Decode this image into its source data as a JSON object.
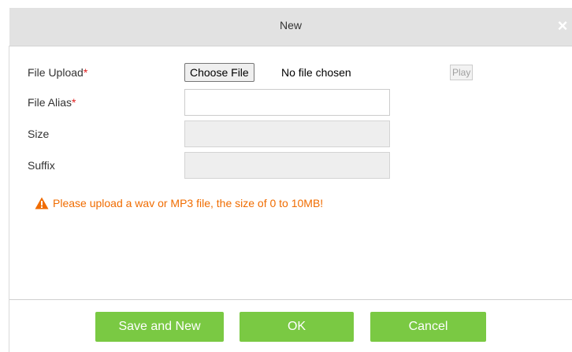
{
  "dialog": {
    "title": "New",
    "close_glyph": "×"
  },
  "form": {
    "file_upload": {
      "label": "File Upload",
      "required_mark": "*",
      "choose_button": "Choose File",
      "status": "No file chosen",
      "play_button": "Play"
    },
    "file_alias": {
      "label": "File Alias",
      "required_mark": "*",
      "value": ""
    },
    "size": {
      "label": "Size",
      "value": ""
    },
    "suffix": {
      "label": "Suffix",
      "value": ""
    }
  },
  "warning": {
    "icon": "warning-triangle-icon",
    "text": "Please upload a wav or MP3 file, the size of 0 to 10MB!"
  },
  "footer": {
    "save_and_new": "Save and New",
    "ok": "OK",
    "cancel": "Cancel"
  },
  "colors": {
    "accent_green": "#7ac943",
    "warning_orange": "#f06c00",
    "required_red": "#e02020",
    "titlebar_gray": "#e2e2e2"
  }
}
